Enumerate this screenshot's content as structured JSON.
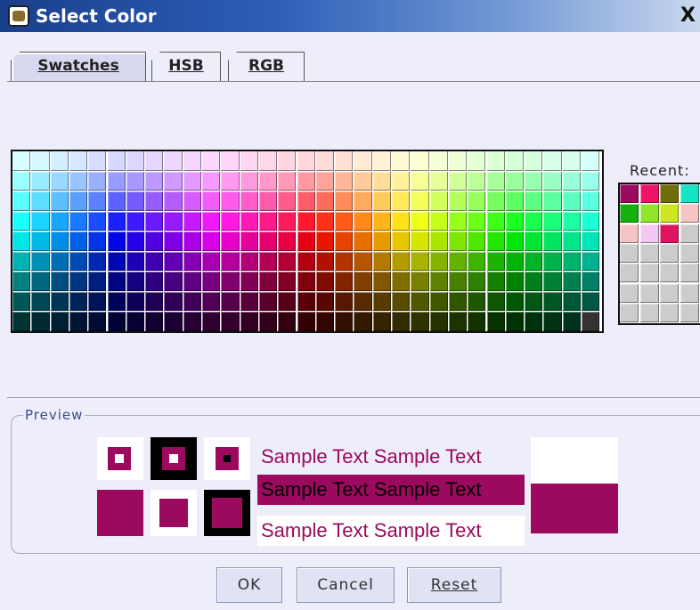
{
  "window": {
    "title": "Select Color",
    "close_label": "X"
  },
  "tabs": [
    {
      "label": "Swatches",
      "active": true
    },
    {
      "label": "HSB",
      "active": false
    },
    {
      "label": "RGB",
      "active": false
    }
  ],
  "recent": {
    "label": "Recent:",
    "colors": [
      [
        "#9b0a5e",
        "#ee1467",
        "#6e6e0a",
        "#16e3c4"
      ],
      [
        "#13b00e",
        "#91e52b",
        "#cfe623",
        "#f6c4c4"
      ],
      [
        "#f5c3c3",
        "#f3c8f2",
        "#e0145e",
        "#cccccc"
      ],
      [
        "#cccccc",
        "#cccccc",
        "#cccccc",
        "#cccccc"
      ],
      [
        "#cccccc",
        "#cccccc",
        "#cccccc",
        "#cccccc"
      ],
      [
        "#cccccc",
        "#cccccc",
        "#cccccc",
        "#cccccc"
      ],
      [
        "#cccccc",
        "#cccccc",
        "#cccccc",
        "#cccccc"
      ]
    ]
  },
  "preview": {
    "label": "Preview",
    "color": "#9b0a5e",
    "samples": [
      "Sample Text",
      "Sample Text",
      "Sample Text",
      "Sample Text",
      "Sample Text",
      "Sample Text"
    ]
  },
  "buttons": {
    "ok": "OK",
    "cancel": "Cancel",
    "reset": "Reset"
  },
  "colors": {
    "window_bg": "#eeeefb",
    "selected": "#9b0a5e"
  }
}
